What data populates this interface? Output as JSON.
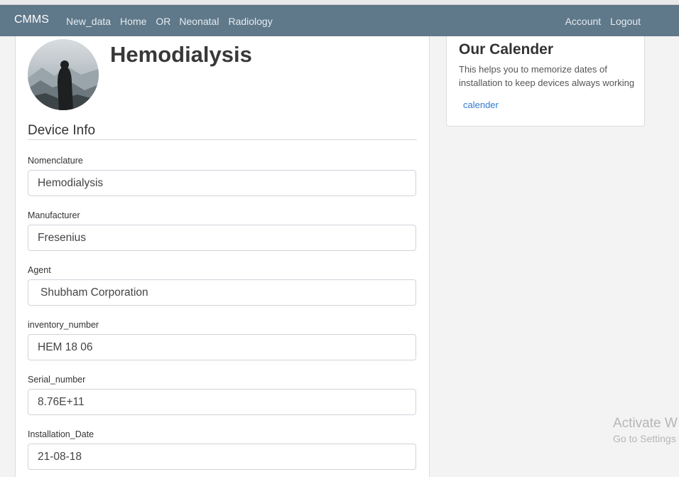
{
  "navbar": {
    "brand": "CMMS",
    "links": [
      "New_data",
      "Home",
      "OR",
      "Neonatal",
      "Radiology"
    ],
    "right_links": [
      "Account",
      "Logout"
    ],
    "bg_color": "#5f788a"
  },
  "device": {
    "title": "Hemodialysis",
    "section_title": "Device Info",
    "fields": [
      {
        "label": "Nomenclature",
        "value": "Hemodialysis"
      },
      {
        "label": "Manufacturer",
        "value": "Fresenius"
      },
      {
        "label": "Agent",
        "value": " Shubham Corporation"
      },
      {
        "label": "inventory_number",
        "value": "HEM 18 06"
      },
      {
        "label": "Serial_number",
        "value": "8.76E+11"
      },
      {
        "label": "Installation_Date",
        "value": "21-08-18"
      }
    ]
  },
  "calendar_card": {
    "title": "Our Calender",
    "text": "This helps you to memorize dates of installation to keep devices always working",
    "link": "calender",
    "link_color": "#2f7ad1"
  },
  "watermark": {
    "line1": "Activate W",
    "line2": "Go to Settings"
  }
}
